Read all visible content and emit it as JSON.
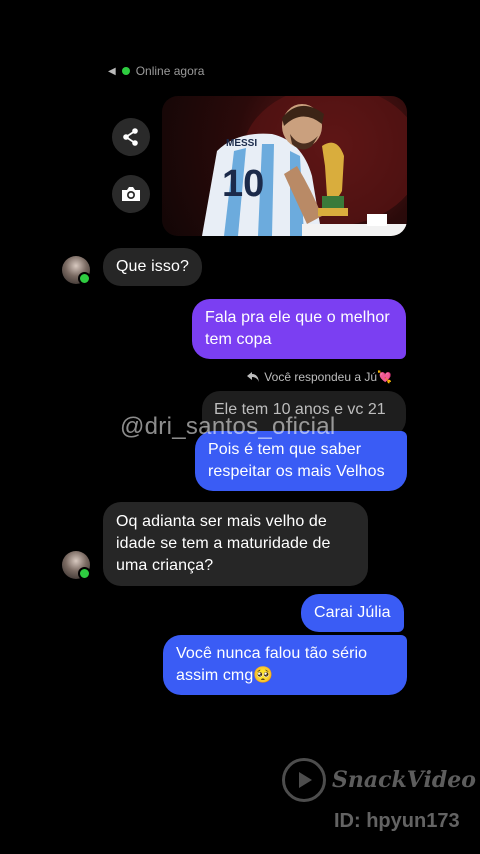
{
  "header": {
    "status_text": "Online agora"
  },
  "attachment_actions": {
    "share": "share-icon",
    "camera": "camera-icon"
  },
  "messages": [
    {
      "text": "Que isso?"
    },
    {
      "text": "Fala pra ele que o melhor tem copa"
    },
    {
      "text": "Ele tem 10 anos e vc 21"
    },
    {
      "text": "Pois é tem que saber respeitar os mais Velhos"
    },
    {
      "text": "Oq adianta ser mais velho de idade se tem a maturidade de uma criança?"
    },
    {
      "text": "Carai Júlia"
    },
    {
      "text": "Você nunca falou tão sério assim cmg🥺"
    }
  ],
  "reply_note": {
    "text": "Você respondeu a Jú💘"
  },
  "watermarks": {
    "handle": "@dri_santos_oficial",
    "app_name": "SnackVideo",
    "user_id": "ID: hpyun173"
  },
  "colors": {
    "purple_bubble": "#7b3ff2",
    "blue_bubble": "#3a5cf5",
    "incoming_bubble": "#262626",
    "online": "#2ecc40"
  }
}
